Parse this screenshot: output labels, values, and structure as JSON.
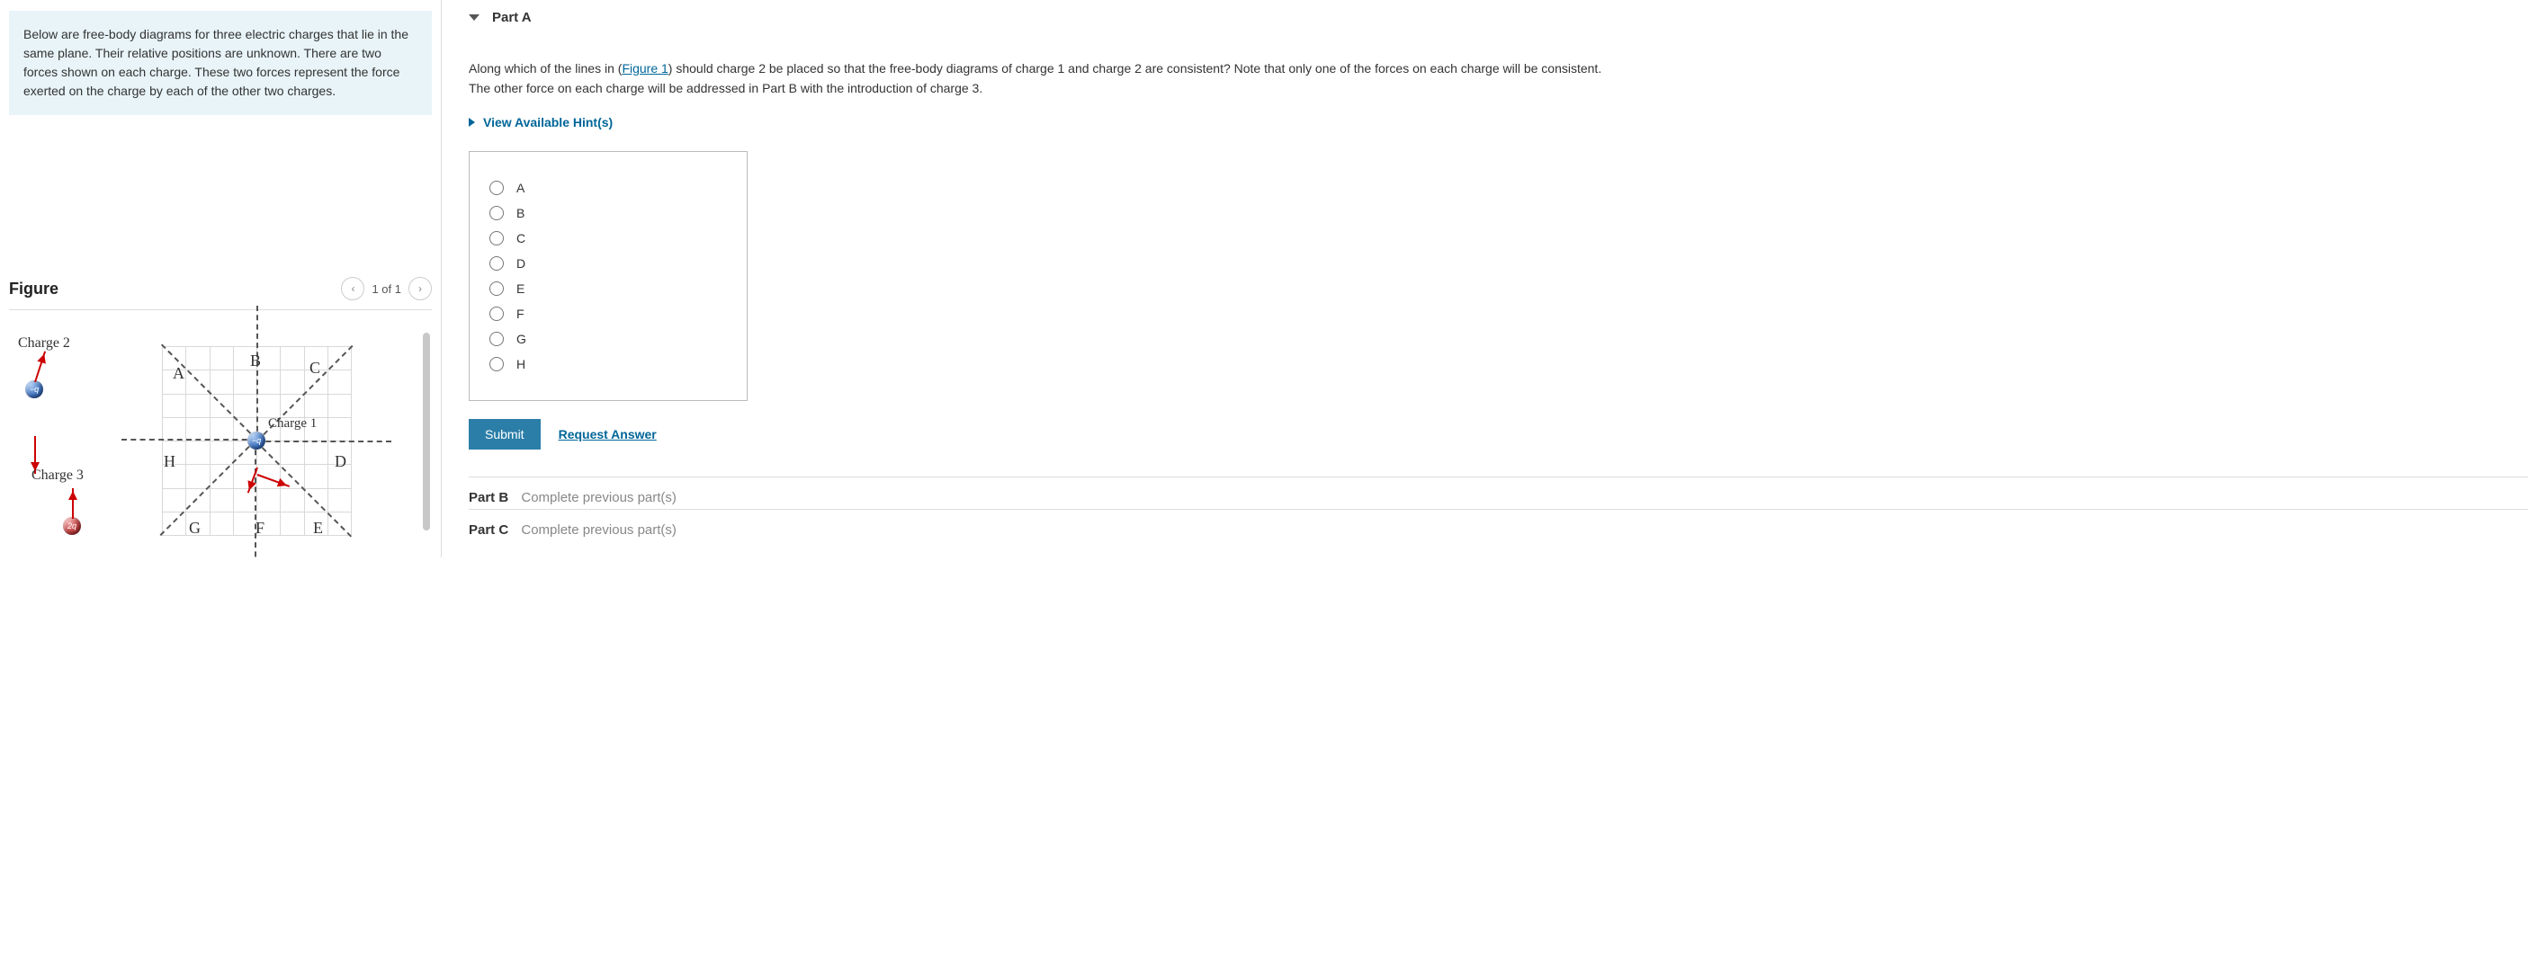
{
  "info_text": "Below are free-body diagrams for three electric charges that lie in the same plane. Their relative positions are unknown. There are two forces shown on each charge. These two forces represent the force exerted on the charge by each of the other two charges.",
  "figure": {
    "title": "Figure",
    "pager": "1 of 1",
    "labels": {
      "charge1": "Charge 1",
      "charge2": "Charge 2",
      "charge3": "Charge 3",
      "A": "A",
      "B": "B",
      "C": "C",
      "D": "D",
      "E": "E",
      "F": "F",
      "G": "G",
      "H": "H",
      "q_neg": "−q",
      "q_2": "2q"
    }
  },
  "partA": {
    "title": "Part A",
    "question_pre": "Along which of the lines in (",
    "figure_link": "Figure 1",
    "question_post": ") should charge 2 be placed so that the free-body diagrams of charge 1 and charge 2 are consistent? Note that only one of the forces on each charge will be consistent. The other force on each charge will be addressed in Part B with the introduction of charge 3.",
    "hints": "View Available Hint(s)",
    "options": [
      "A",
      "B",
      "C",
      "D",
      "E",
      "F",
      "G",
      "H"
    ],
    "submit": "Submit",
    "request": "Request Answer"
  },
  "partB": {
    "label": "Part B",
    "status": "Complete previous part(s)"
  },
  "partC": {
    "label": "Part C",
    "status": "Complete previous part(s)"
  }
}
